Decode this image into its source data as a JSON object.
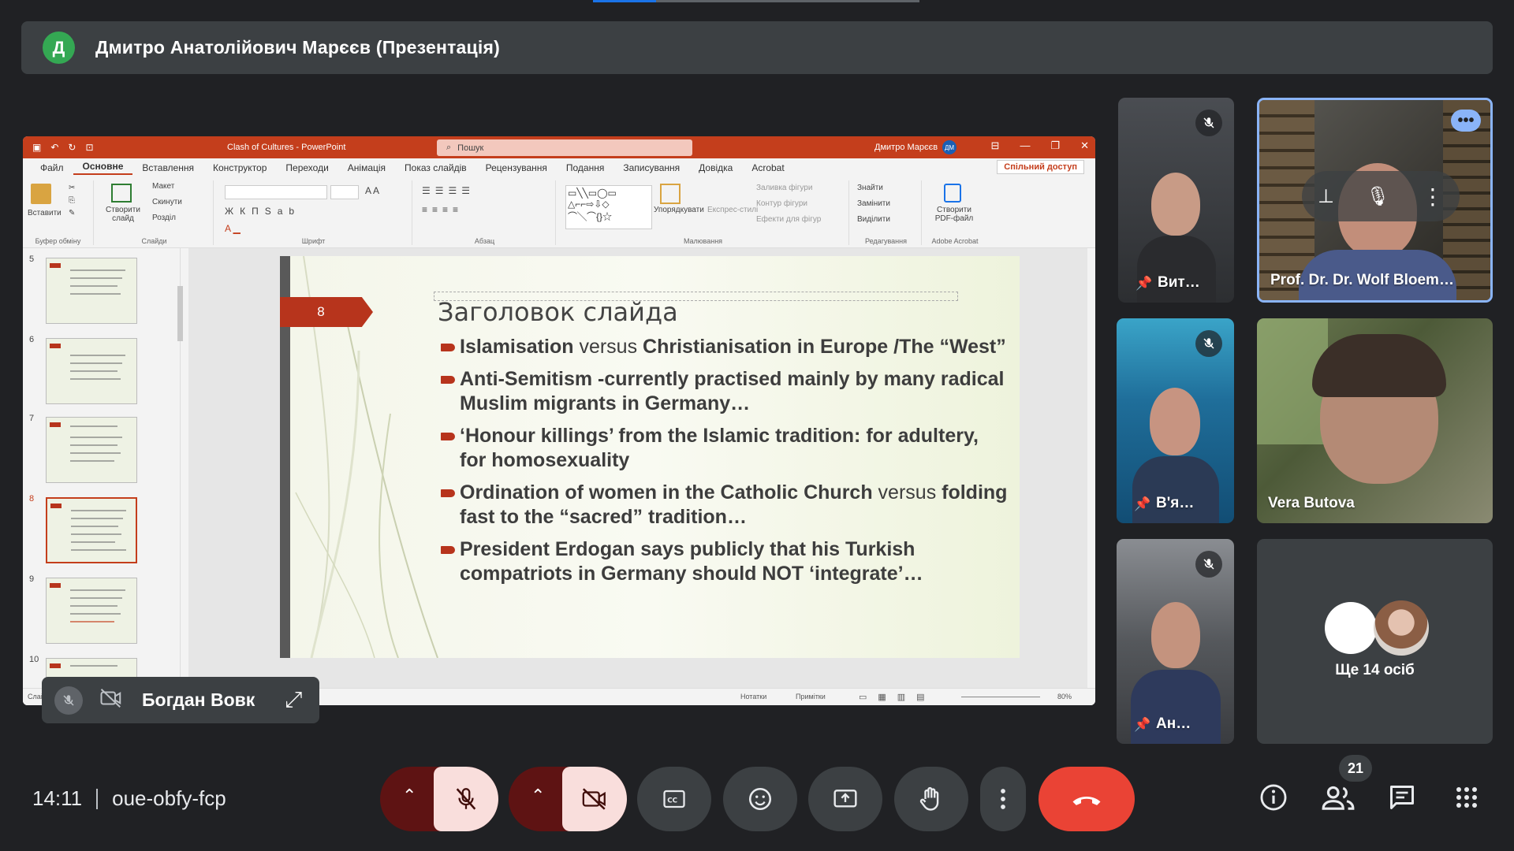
{
  "meeting": {
    "presenter_initial": "Д",
    "presenter_label": "Дмитро Анатолійович Марєєв (Презентація)",
    "time": "14:11",
    "code": "oue-obfy-fcp",
    "participant_count": "21",
    "others_label": "Ще 14 осіб"
  },
  "powerpoint": {
    "doc_title": "Clash of Cultures  -  PowerPoint",
    "search_placeholder": "Пошук",
    "user_name": "Дмитро Марєєв",
    "user_initials": "ДМ",
    "tabs": [
      "Файл",
      "Основне",
      "Вставлення",
      "Конструктор",
      "Переходи",
      "Анімація",
      "Показ слайдів",
      "Рецензування",
      "Подання",
      "Записування",
      "Довідка",
      "Acrobat"
    ],
    "share_label": "Спільний доступ",
    "groups": {
      "clipboard": "Буфер обміну",
      "slides": "Слайди",
      "font": "Шрифт",
      "paragraph": "Абзац",
      "drawing": "Малювання",
      "editing": "Редагування",
      "acrobat": "Adobe Acrobat"
    },
    "ribbon": {
      "paste": "Вставити",
      "new_slide": "Створити слайд",
      "layout": "Макет",
      "reset": "Скинути",
      "section": "Розділ",
      "arrange": "Упорядкувати",
      "quick_styles": "Експрес-стилі",
      "fill": "Заливка фігури",
      "outline": "Контур фігури",
      "effects": "Ефекти для фігур",
      "find": "Знайти",
      "replace": "Замінити",
      "select": "Виділити",
      "create_pdf": "Створити PDF-файл"
    },
    "thumb_numbers": [
      "5",
      "6",
      "7",
      "8",
      "9",
      "10"
    ],
    "status": {
      "slide_label": "Слайд",
      "notes": "Нотатки",
      "comments": "Примітки",
      "zoom": "80%"
    }
  },
  "slide": {
    "number": "8",
    "title": "Заголовок слайда",
    "b1_bold1": "Islamisation",
    "b1_thin": " versus ",
    "b1_bold2": "Christianisation in Europe /The “West”",
    "b2": "Anti-Semitism -currently practised mainly by many radical Muslim migrants in Germany…",
    "b3": "‘Honour killings’ from the Islamic tradition: for adultery, for homosexuality",
    "b4_bold1": "Ordination of women in the Catholic Church",
    "b4_thin": " versus ",
    "b4_bold2": "folding fast to the “sacred” tradition…",
    "b5": "President Erdogan says publicly that his Turkish compatriots in Germany should NOT ‘integrate’…"
  },
  "participants": {
    "vit": "Вит…",
    "wolf": "Prof. Dr. Dr. Wolf Bloem…",
    "vya": "В'я…",
    "vera": "Vera Butova",
    "an": "Ан…",
    "bogdan": "Богдан Вовк"
  },
  "icons": [
    "mic-off-icon",
    "camera-off-icon",
    "captions-icon",
    "emoji-icon",
    "present-icon",
    "raise-hand-icon",
    "more-vert-icon",
    "end-call-icon",
    "info-icon",
    "people-icon",
    "chat-icon",
    "apps-icon",
    "pin-icon",
    "expand-icon"
  ],
  "colors": {
    "end_call": "#ea4335",
    "ppt_red": "#c43e1c",
    "accent_blue": "#1a73e8",
    "mute_pink": "#f9dedc"
  }
}
